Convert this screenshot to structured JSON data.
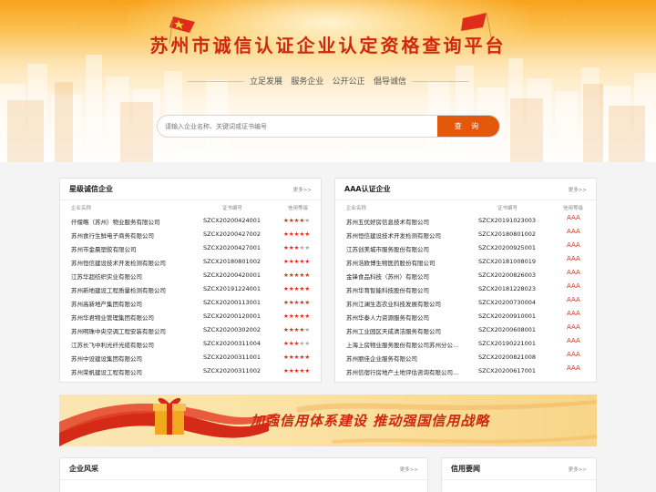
{
  "hero": {
    "title": "苏州市诚信认证企业认定资格查询平台",
    "slogans": [
      "立足发展",
      "服务企业",
      "公开公正",
      "倡导诚信"
    ],
    "search_placeholder": "请输入企业名称、关键词或证书编号",
    "search_button": "查 询"
  },
  "star_panel": {
    "title": "星级诚信企业",
    "more": "更多>>",
    "columns": [
      "企业名称",
      "证书编号",
      "信用等级"
    ],
    "rows": [
      {
        "name": "仟偃略（苏州）物业服务有限公司",
        "cert": "SZCX20200424001",
        "stars": 4
      },
      {
        "name": "苏州食行生鲜电子商务有限公司",
        "cert": "SZCX20200427002",
        "stars": 5
      },
      {
        "name": "苏州市金晨塑胶有限公司",
        "cert": "SZCX20200427001",
        "stars": 3
      },
      {
        "name": "苏州恒信建设技术开发检测有限公司",
        "cert": "SZCX20180801002",
        "stars": 5
      },
      {
        "name": "江苏华超纺织实业有限公司",
        "cert": "SZCX20200420001",
        "stars": 5
      },
      {
        "name": "苏州新地建设工程质量检测有限公司",
        "cert": "SZCX20191224001",
        "stars": 5
      },
      {
        "name": "苏州高新地产集团有限公司",
        "cert": "SZCX20200113001",
        "stars": 5
      },
      {
        "name": "苏州华君物业管理集团有限公司",
        "cert": "SZCX20200120001",
        "stars": 5
      },
      {
        "name": "苏州明珠中央空调工程安装有限公司",
        "cert": "SZCX20200302002",
        "stars": 4
      },
      {
        "name": "江苏长飞中利光纤光缆有限公司",
        "cert": "SZCX20200311004",
        "stars": 3
      },
      {
        "name": "苏州中设建设集团有限公司",
        "cert": "SZCX20200311001",
        "stars": 5
      },
      {
        "name": "苏州荣帆建设工程有限公司",
        "cert": "SZCX20200311002",
        "stars": 5
      }
    ]
  },
  "aaa_panel": {
    "title": "AAA认证企业",
    "more": "更多>>",
    "columns": [
      "企业名称",
      "证书编号",
      "信用等级"
    ],
    "rows": [
      {
        "name": "苏州五优好房信息技术有限公司",
        "cert": "SZCX20191023003",
        "level": "AAA"
      },
      {
        "name": "苏州恒信建设技术开发检测有限公司",
        "cert": "SZCX20180801002",
        "level": "AAA"
      },
      {
        "name": "江苏创美城市服务股份有限公司",
        "cert": "SZCX20200925001",
        "level": "AAA"
      },
      {
        "name": "苏州浩欧博生物医药股份有限公司",
        "cert": "SZCX20181008019",
        "level": "AAA"
      },
      {
        "name": "金锋食品科技（苏州）有限公司",
        "cert": "SZCX20200826003",
        "level": "AAA"
      },
      {
        "name": "苏州华育智能科技股份有限公司",
        "cert": "SZCX20181228023",
        "level": "AAA"
      },
      {
        "name": "苏州江澜生态农业科技发展有限公司",
        "cert": "SZCX20200730004",
        "level": "AAA"
      },
      {
        "name": "苏州华泰人力资源服务有限公司",
        "cert": "SZCX20200910001",
        "level": "AAA"
      },
      {
        "name": "苏州工业园区天成清洁服务有限公司",
        "cert": "SZCX20200608001",
        "level": "AAA"
      },
      {
        "name": "上海上房物业服务股份有限公司苏州分公...",
        "cert": "SZCX20190221001",
        "level": "AAA"
      },
      {
        "name": "苏州丽佳企业服务有限公司",
        "cert": "SZCX20200821008",
        "level": "AAA"
      },
      {
        "name": "苏州信宿行房地产土地评估咨询有限公司...",
        "cert": "SZCX20200617001",
        "level": "AAA"
      }
    ]
  },
  "banner": {
    "slogan": "加强信用体系建设 推动强国信用战略"
  },
  "news_left": {
    "title": "企业风采",
    "more": "更多>>"
  },
  "news_right": {
    "title": "信用要闻",
    "more": "更多>>"
  },
  "colors": {
    "brand_red": "#d0280f",
    "search_orange": "#e4580b",
    "star_red": "#e02c1a",
    "star_gray": "#a8a8a8"
  }
}
